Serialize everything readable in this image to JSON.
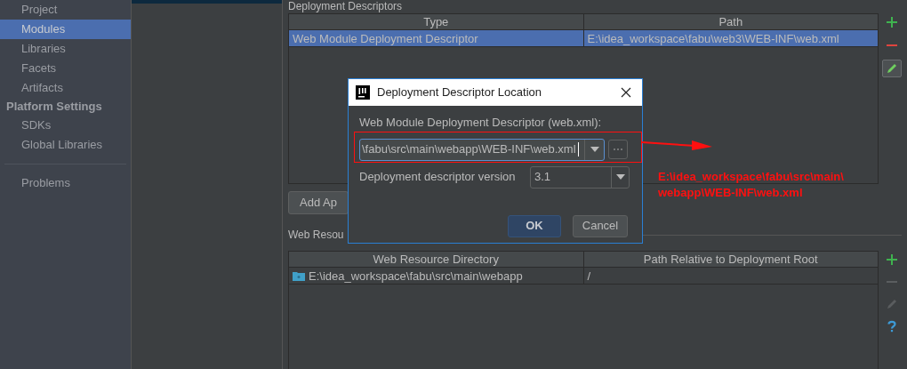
{
  "sidebar": {
    "items": [
      {
        "kind": "item",
        "label": "Project",
        "selected": false
      },
      {
        "kind": "item",
        "label": "Modules",
        "selected": true
      },
      {
        "kind": "item",
        "label": "Libraries",
        "selected": false
      },
      {
        "kind": "item",
        "label": "Facets",
        "selected": false
      },
      {
        "kind": "item",
        "label": "Artifacts",
        "selected": false
      },
      {
        "kind": "header",
        "label": "Platform Settings",
        "selected": false
      },
      {
        "kind": "item",
        "label": "SDKs",
        "selected": false
      },
      {
        "kind": "item",
        "label": "Global Libraries",
        "selected": false
      },
      {
        "kind": "divider",
        "selected": false
      },
      {
        "kind": "item",
        "label": "Problems",
        "selected": false
      }
    ]
  },
  "deployment_descriptors": {
    "title": "Deployment Descriptors",
    "columns": [
      "Type",
      "Path"
    ],
    "rows": [
      {
        "cells": [
          "Web Module Deployment Descriptor",
          "E:\\idea_workspace\\fabu\\web3\\WEB-INF\\web.xml"
        ],
        "selected": true
      }
    ],
    "toolbar": [
      {
        "kind": "add",
        "disabled": false
      },
      {
        "kind": "remove",
        "disabled": false
      },
      {
        "kind": "edit",
        "disabled": false
      }
    ]
  },
  "add_button": {
    "label": "Add Ap"
  },
  "web_resources": {
    "title": "Web Resou",
    "columns": [
      "Web Resource Directory",
      "Path Relative to Deployment Root"
    ],
    "rows": [
      {
        "cells": [
          "E:\\idea_workspace\\fabu\\src\\main\\webapp",
          "/"
        ],
        "selected": false
      }
    ],
    "toolbar": [
      {
        "kind": "add",
        "disabled": false
      },
      {
        "kind": "remove",
        "disabled": true
      },
      {
        "kind": "edit",
        "disabled": true
      },
      {
        "kind": "help",
        "disabled": false
      }
    ]
  },
  "dialog": {
    "title": "Deployment Descriptor Location",
    "field_label": "Web Module Deployment Descriptor (web.xml):",
    "field_value": "\\fabu\\src\\main\\webapp\\WEB-INF\\web.xml",
    "version_label": "Deployment descriptor version",
    "version_value": "3.1",
    "buttons": [
      {
        "label": "OK",
        "default": true
      },
      {
        "label": "Cancel",
        "default": false
      }
    ]
  },
  "annotation": {
    "lines": [
      "E:\\idea_workspace\\fabu\\src\\main\\",
      "webapp\\WEB-INF\\web.xml"
    ]
  }
}
